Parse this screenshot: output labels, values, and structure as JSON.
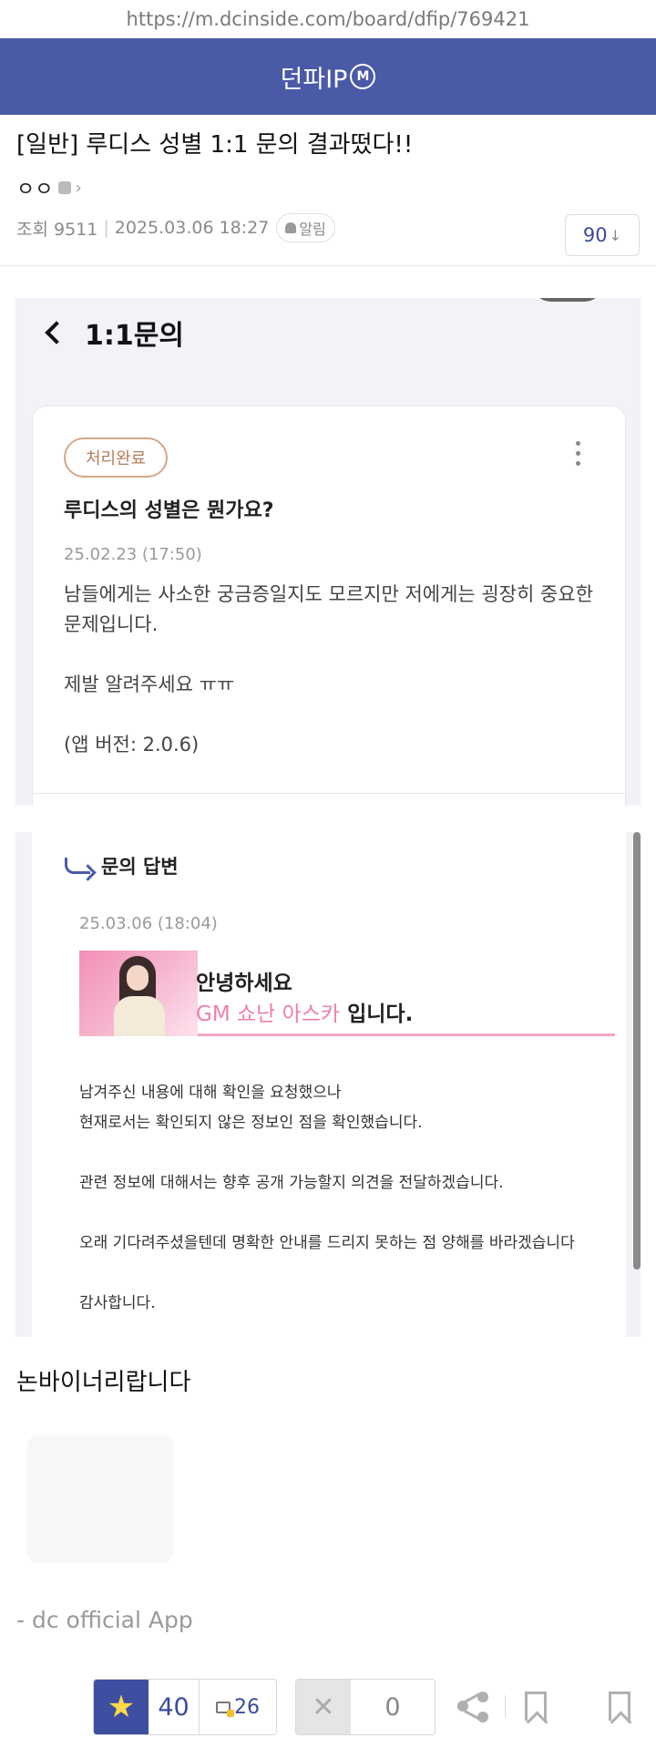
{
  "browser": {
    "url": "https://m.dcinside.com/board/dfip/769421"
  },
  "header": {
    "gallery_name": "던파IP",
    "badge": "M"
  },
  "post": {
    "title": "[일반] 루디스 성별 1:1 문의 결과떴다!!",
    "writer": "ㅇㅇ",
    "views_label": "조회 9511",
    "datetime": "2025.03.06 18:27",
    "alarm_label": "알림",
    "reco_count": "90",
    "reco_arrow": "↓"
  },
  "inquiry_screen": {
    "back_title": "1:1문의",
    "status": "처리완료",
    "question_title": "루디스의 성별은 뭔가요?",
    "question_date": "25.02.23 (17:50)",
    "question_body": [
      "남들에게는 사소한 궁금증일지도 모르지만 저에게는 굉장히 중요한 문제입니다.",
      "제발 알려주세요 ㅠㅠ",
      "(앱 버전: 2.0.6)"
    ]
  },
  "answer_screen": {
    "title": "문의 답변",
    "date": "25.03.06 (18:04)",
    "greeting": "안녕하세요",
    "gm_name": "GM 쇼난 아스카",
    "gm_suffix": " 입니다.",
    "body": [
      "남겨주신 내용에 대해 확인을 요청했으나",
      "현재로서는 확인되지 않은 정보인 점을 확인했습니다.",
      "관련 정보에 대해서는 향후 공개 가능할지 의견을 전달하겠습니다.",
      "오래 기다려주셨을텐데 명확한 안내를 드리지 못하는 점 양해를 바라겠습니다",
      "감사합니다."
    ]
  },
  "content": {
    "text": "논바이너리랍니다",
    "signature": "- dc official App"
  },
  "bottom_bar": {
    "reco_count": "40",
    "fix_count": "26",
    "nonreco_count": "0"
  },
  "colors": {
    "brand": "#4b5aa7",
    "accent_pink": "#ef7fae",
    "star": "#ffd84a"
  }
}
